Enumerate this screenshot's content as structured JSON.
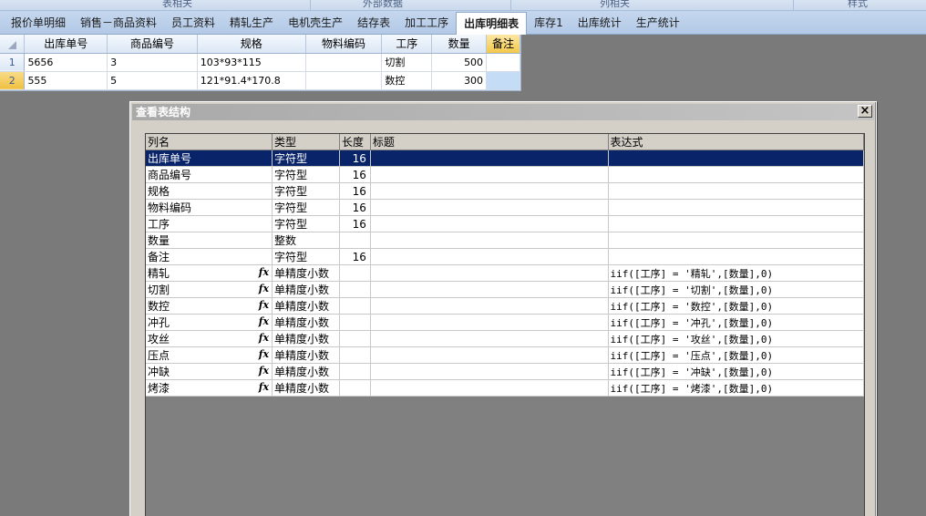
{
  "ribbon_groups": [
    "表相关",
    "外部数据",
    "列相关",
    "样式"
  ],
  "tabs": [
    {
      "label": "报价单明细",
      "active": false
    },
    {
      "label": "销售－商品资料",
      "active": false
    },
    {
      "label": "员工资料",
      "active": false
    },
    {
      "label": "精轧生产",
      "active": false
    },
    {
      "label": "电机壳生产",
      "active": false
    },
    {
      "label": "结存表",
      "active": false
    },
    {
      "label": "加工工序",
      "active": false
    },
    {
      "label": "出库明细表",
      "active": true
    },
    {
      "label": "库存1",
      "active": false
    },
    {
      "label": "出库统计",
      "active": false
    },
    {
      "label": "生产统计",
      "active": false
    }
  ],
  "grid": {
    "columns": [
      "出库单号",
      "商品编号",
      "规格",
      "物料编码",
      "工序",
      "数量",
      "备注"
    ],
    "rows": [
      {
        "num": "1",
        "cells": [
          "5656",
          "3",
          "103*93*115",
          "",
          "切割",
          "500",
          ""
        ]
      },
      {
        "num": "2",
        "cells": [
          "555",
          "5",
          "121*91.4*170.8",
          "",
          "数控",
          "300",
          ""
        ]
      }
    ]
  },
  "dialog": {
    "title": "查看表结构",
    "close_label": "×",
    "columns": [
      "列名",
      "类型",
      "长度",
      "标题",
      "表达式"
    ],
    "rows": [
      {
        "name": "出库单号",
        "type": "字符型",
        "length": "16",
        "title": "",
        "expr": "",
        "fx": false
      },
      {
        "name": "商品编号",
        "type": "字符型",
        "length": "16",
        "title": "",
        "expr": "",
        "fx": false
      },
      {
        "name": "规格",
        "type": "字符型",
        "length": "16",
        "title": "",
        "expr": "",
        "fx": false
      },
      {
        "name": "物料编码",
        "type": "字符型",
        "length": "16",
        "title": "",
        "expr": "",
        "fx": false
      },
      {
        "name": "工序",
        "type": "字符型",
        "length": "16",
        "title": "",
        "expr": "",
        "fx": false
      },
      {
        "name": "数量",
        "type": "整数",
        "length": "",
        "title": "",
        "expr": "",
        "fx": false
      },
      {
        "name": "备注",
        "type": "字符型",
        "length": "16",
        "title": "",
        "expr": "",
        "fx": false
      },
      {
        "name": "精轧",
        "type": "单精度小数",
        "length": "",
        "title": "",
        "expr": "iif([工序] = '精轧',[数量],0)",
        "fx": true
      },
      {
        "name": "切割",
        "type": "单精度小数",
        "length": "",
        "title": "",
        "expr": "iif([工序] = '切割',[数量],0)",
        "fx": true
      },
      {
        "name": "数控",
        "type": "单精度小数",
        "length": "",
        "title": "",
        "expr": "iif([工序] = '数控',[数量],0)",
        "fx": true
      },
      {
        "name": "冲孔",
        "type": "单精度小数",
        "length": "",
        "title": "",
        "expr": "iif([工序] = '冲孔',[数量],0)",
        "fx": true
      },
      {
        "name": "攻丝",
        "type": "单精度小数",
        "length": "",
        "title": "",
        "expr": "iif([工序] = '攻丝',[数量],0)",
        "fx": true
      },
      {
        "name": "压点",
        "type": "单精度小数",
        "length": "",
        "title": "",
        "expr": "iif([工序] = '压点',[数量],0)",
        "fx": true
      },
      {
        "name": "冲缺",
        "type": "单精度小数",
        "length": "",
        "title": "",
        "expr": "iif([工序] = '冲缺',[数量],0)",
        "fx": true
      },
      {
        "name": "烤漆",
        "type": "单精度小数",
        "length": "",
        "title": "",
        "expr": "iif([工序] = '烤漆',[数量],0)",
        "fx": true
      }
    ],
    "fx_label": "fx"
  },
  "colors": {
    "selected_row": "#0a246a",
    "active_cell": "#c5dcf7",
    "workspace": "#7a7a7a"
  }
}
